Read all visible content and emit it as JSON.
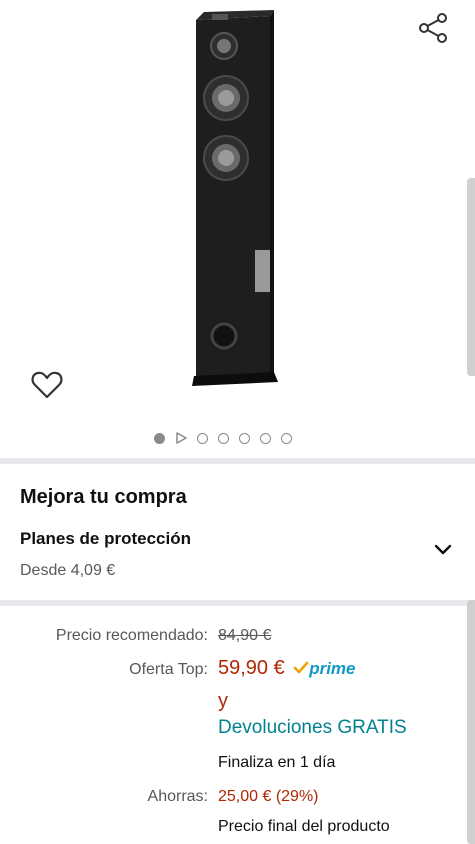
{
  "gallery": {
    "dots_total": 7,
    "active_index": 0
  },
  "upgrade": {
    "title": "Mejora tu compra",
    "plan_title": "Planes de protección",
    "plan_price": "Desde 4,09 €"
  },
  "pricing": {
    "list_label": "Precio recomendado:",
    "list_price": "84,90 €",
    "deal_label": "Oferta Top:",
    "deal_price": "59,90 €",
    "prime_label": "prime",
    "and_text": "y",
    "returns_text": "Devoluciones GRATIS",
    "ends_text": "Finaliza en 1 día",
    "savings_label": "Ahorras:",
    "savings_value": "25,00 € (29%)",
    "final_text": "Precio final del producto"
  }
}
